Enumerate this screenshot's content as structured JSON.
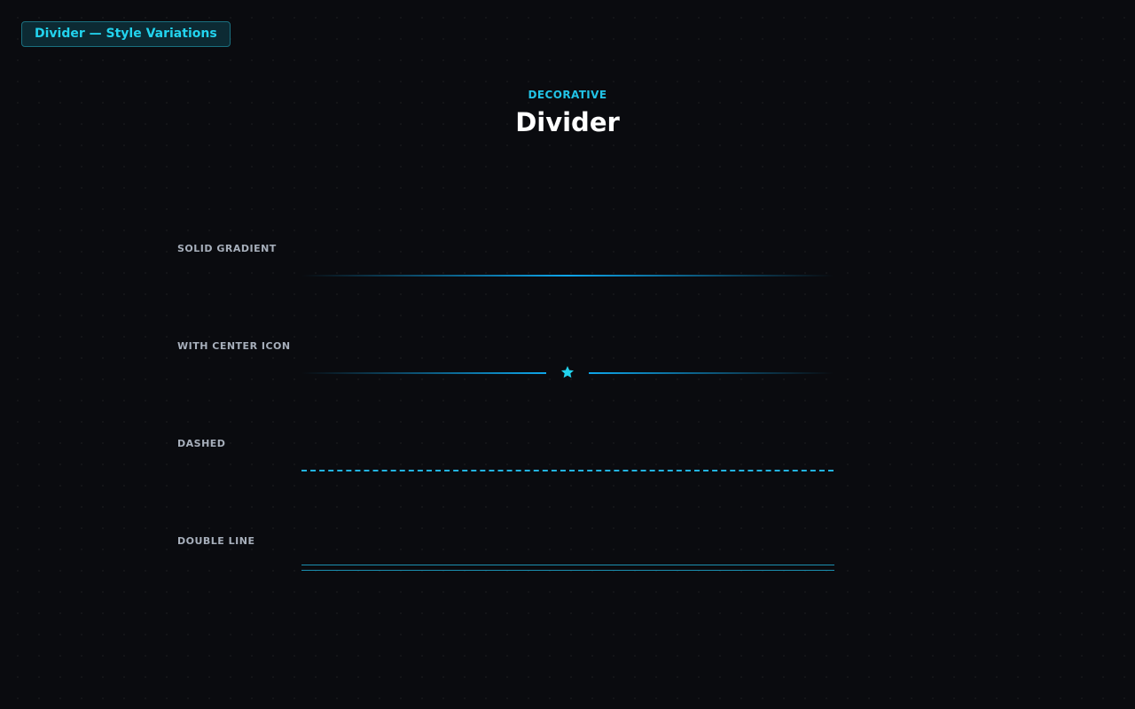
{
  "badge": {
    "label": "Divider — Style Variations"
  },
  "header": {
    "eyebrow": "DECORATIVE",
    "title": "Divider"
  },
  "variants": [
    {
      "label": "SOLID GRADIENT",
      "style": "solid-gradient"
    },
    {
      "label": "WITH CENTER ICON",
      "style": "center-icon",
      "icon": "star-icon"
    },
    {
      "label": "DASHED",
      "style": "dashed"
    },
    {
      "label": "DOUBLE LINE",
      "style": "double"
    }
  ],
  "colors": {
    "background": "#0a0b0f",
    "accent": "#22d3ee",
    "line": "#0ea5e9",
    "label": "#a7afbb",
    "title": "#ffffff"
  }
}
